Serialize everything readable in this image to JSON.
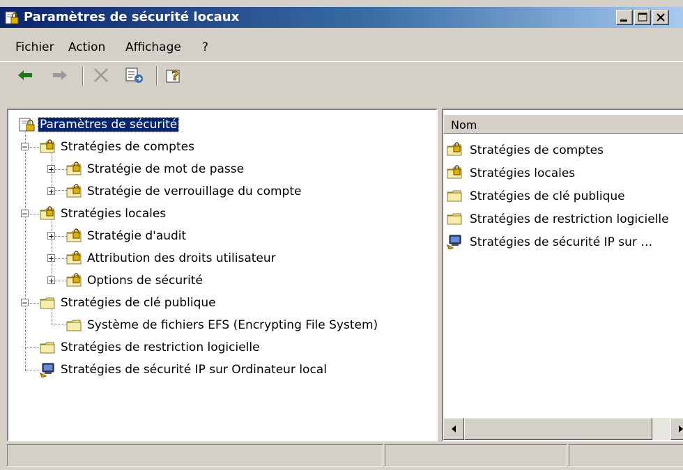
{
  "window": {
    "title": "Paramètres de sécurité locaux",
    "icon": "security-settings-icon",
    "controls": [
      "minimize-icon",
      "maximize-icon",
      "close-icon"
    ]
  },
  "menu": [
    {
      "label": "Fichier"
    },
    {
      "label": "Action"
    },
    {
      "label": "Affichage"
    },
    {
      "label": "?"
    }
  ],
  "toolbar": [
    "back-arrow-icon",
    "forward-arrow-icon",
    "delete-icon",
    "export-list-icon",
    "help-icon"
  ],
  "tree": {
    "root": {
      "label": "Paramètres de sécurité",
      "selected": true
    },
    "nodes": [
      {
        "label": "Stratégies de comptes",
        "icon": "locked-folder-icon",
        "expander": "−"
      },
      {
        "label": "Stratégie de mot de passe",
        "icon": "locked-folder-icon",
        "expander": "+"
      },
      {
        "label": "Stratégie de verrouillage du compte",
        "icon": "locked-folder-icon",
        "expander": "+"
      },
      {
        "label": "Stratégies locales",
        "icon": "locked-folder-icon",
        "expander": "−"
      },
      {
        "label": "Stratégie d'audit",
        "icon": "locked-folder-icon",
        "expander": "+"
      },
      {
        "label": "Attribution des droits utilisateur",
        "icon": "locked-folder-icon",
        "expander": "+"
      },
      {
        "label": "Options de sécurité",
        "icon": "locked-folder-icon",
        "expander": "+"
      },
      {
        "label": "Stratégies de clé publique",
        "icon": "folder-icon",
        "expander": "−"
      },
      {
        "label": "Système de fichiers EFS (Encrypting File System)",
        "icon": "folder-icon",
        "expander": ""
      },
      {
        "label": "Stratégies de restriction logicielle",
        "icon": "folder-icon",
        "expander": ""
      },
      {
        "label": "Stratégies de sécurité IP sur Ordinateur local",
        "icon": "ip-security-icon",
        "expander": ""
      }
    ]
  },
  "list": {
    "column_header": "Nom",
    "items": [
      {
        "label": "Stratégies de comptes",
        "icon": "locked-folder-icon"
      },
      {
        "label": "Stratégies locales",
        "icon": "locked-folder-icon"
      },
      {
        "label": "Stratégies de clé publique",
        "icon": "folder-icon"
      },
      {
        "label": "Stratégies de restriction logicielle",
        "icon": "folder-icon"
      },
      {
        "label": "Stratégies de sécurité IP sur …",
        "icon": "ip-security-icon"
      }
    ]
  },
  "colors": {
    "title_gradient_start": "#0a246a",
    "title_gradient_end": "#a6caf0",
    "face": "#d4d0c8",
    "selection": "#0a246a",
    "folder": "#f4e28c"
  }
}
